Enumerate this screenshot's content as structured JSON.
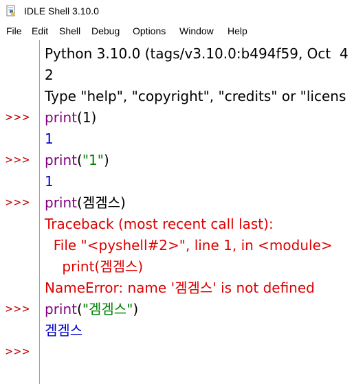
{
  "window": {
    "title": "IDLE Shell 3.10.0"
  },
  "menubar": {
    "items": [
      "File",
      "Edit",
      "Shell",
      "Debug",
      "Options",
      "Window",
      "Help"
    ]
  },
  "shell": {
    "prompt_symbol": ">>>",
    "banner": [
      "Python 3.10.0 (tags/v3.10.0:b494f59, Oct  4",
      "2",
      "Type \"help\", \"copyright\", \"credits\" or \"licens"
    ],
    "session": {
      "in1_func": "print",
      "in1_open": "(",
      "in1_arg": "1",
      "in1_close": ")",
      "out1": "1",
      "in2_func": "print",
      "in2_open": "(",
      "in2_arg": "\"1\"",
      "in2_close": ")",
      "out2": "1",
      "in3_func": "print",
      "in3_open": "(",
      "in3_arg": "겜겜스",
      "in3_close": ")",
      "tb_header": "Traceback (most recent call last):",
      "tb_file": "  File \"<pyshell#2>\", line 1, in <module>",
      "tb_code": "    print(겜겜스)",
      "tb_error": "NameError: name '겜겜스' is not defined",
      "in4_func": "print",
      "in4_open": "(",
      "in4_arg": "\"겜겜스\"",
      "in4_close": ")",
      "out4": "겜겜스"
    }
  },
  "colors": {
    "prompt": "#c00000",
    "builtin": "#800080",
    "stdout": "#0000cc",
    "string": "#008000",
    "stderr": "#dd0000"
  },
  "icons": {
    "app": "python-idle-icon"
  }
}
